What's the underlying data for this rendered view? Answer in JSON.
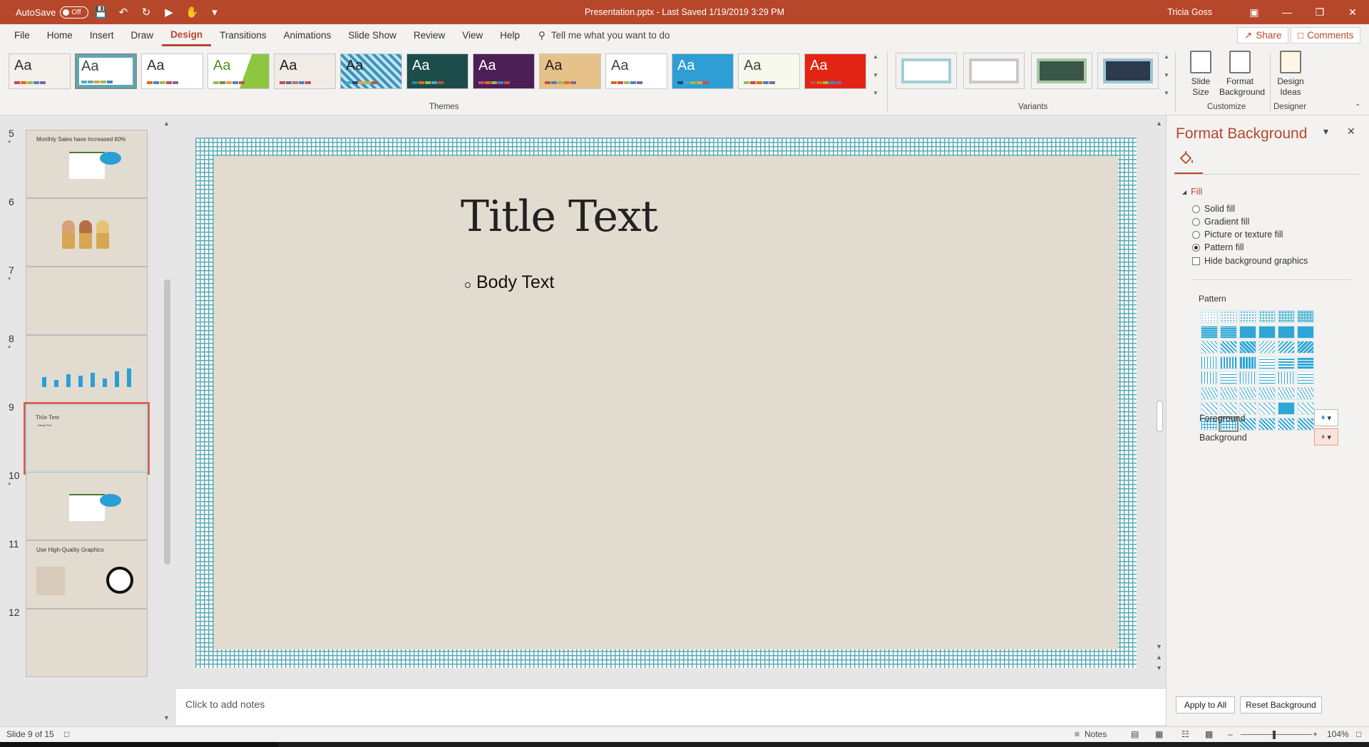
{
  "titlebar": {
    "autosave_label": "AutoSave",
    "autosave_state": "Off",
    "doc_title": "Presentation.pptx  -  Last Saved 1/19/2019 3:29 PM",
    "user": "Tricia Goss",
    "accent_color": "#b7472a"
  },
  "menu": {
    "tabs": [
      "File",
      "Home",
      "Insert",
      "Draw",
      "Design",
      "Transitions",
      "Animations",
      "Slide Show",
      "Review",
      "View",
      "Help"
    ],
    "active_tab": "Design",
    "tell_me": "Tell me what you want to do",
    "share": "Share",
    "comments": "Comments"
  },
  "ribbon": {
    "themes_label": "Themes",
    "variants_label": "Variants",
    "customize_label": "Customize",
    "designer_label": "Designer",
    "theme_aa": "Aa",
    "slide_size_line1": "Slide",
    "slide_size_line2": "Size",
    "format_bg_line1": "Format",
    "format_bg_line2": "Background",
    "design_ideas_line1": "Design",
    "design_ideas_line2": "Ideas"
  },
  "thumbnails": [
    {
      "num": "5",
      "star": true,
      "text": "Monthly Sales have Increased 60%"
    },
    {
      "num": "6",
      "star": false,
      "text": ""
    },
    {
      "num": "7",
      "star": true,
      "text": ""
    },
    {
      "num": "8",
      "star": true,
      "text": ""
    },
    {
      "num": "9",
      "star": false,
      "text": "Title Text",
      "sub": "• Body Text",
      "current": true
    },
    {
      "num": "10",
      "star": true,
      "text": ""
    },
    {
      "num": "11",
      "star": false,
      "text": "Use High-Quality Graphics"
    },
    {
      "num": "12",
      "star": false,
      "text": ""
    }
  ],
  "slide": {
    "title": "Title Text",
    "body": "Body Text"
  },
  "notes_placeholder": "Click to add notes",
  "format_pane": {
    "title": "Format Background",
    "section": "Fill",
    "options": [
      "Solid fill",
      "Gradient fill",
      "Picture or texture fill",
      "Pattern fill"
    ],
    "selected_option": "Pattern fill",
    "hide_graphics": "Hide background graphics",
    "pattern_label": "Pattern",
    "foreground_label": "Foreground",
    "background_label": "Background",
    "apply_all": "Apply to All",
    "reset": "Reset Background"
  },
  "statusbar": {
    "slide_info": "Slide 9 of 15",
    "notes": "Notes",
    "zoom": "104%"
  }
}
